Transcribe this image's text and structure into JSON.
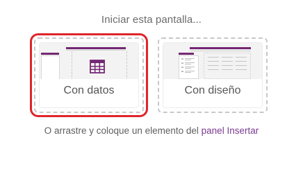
{
  "heading": "Iniciar esta pantalla...",
  "cards": [
    {
      "label": "Con datos",
      "selected": true,
      "icon": "table-icon"
    },
    {
      "label": "Con diseño",
      "selected": false,
      "icon": "layout-icon"
    }
  ],
  "footer": {
    "text": "O arrastre y coloque un elemento del",
    "link": "panel Insertar"
  },
  "colors": {
    "accent": "#742774",
    "selection": "#e0242b",
    "link": "#7a3b91"
  }
}
